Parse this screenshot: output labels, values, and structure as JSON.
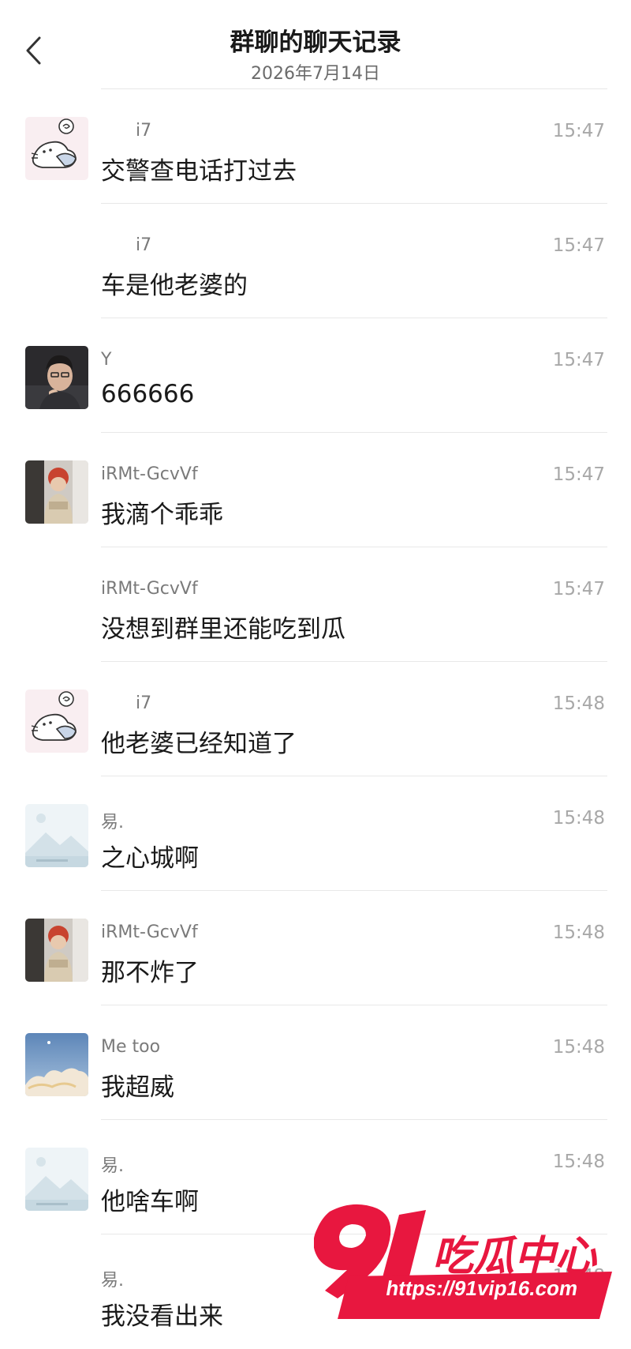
{
  "header": {
    "title": "群聊的聊天记录",
    "subtitle": "2026年7月14日"
  },
  "messages": [
    {
      "sender": "i7",
      "time": "15:47",
      "text": "交警查电话打过去",
      "avatar": "cat-cartoon"
    },
    {
      "sender": "i7",
      "time": "15:47",
      "text": "车是他老婆的",
      "avatar": ""
    },
    {
      "sender": "Y",
      "time": "15:47",
      "text": "666666",
      "avatar": "person-photo"
    },
    {
      "sender": "iRMt-GcvVf",
      "time": "15:47",
      "text": "我滴个乖乖",
      "avatar": "child-photo"
    },
    {
      "sender": "iRMt-GcvVf",
      "time": "15:47",
      "text": "没想到群里还能吃到瓜",
      "avatar": ""
    },
    {
      "sender": "i7",
      "time": "15:48",
      "text": "他老婆已经知道了",
      "avatar": "cat-cartoon"
    },
    {
      "sender": "易.",
      "time": "15:48",
      "text": "之心城啊",
      "avatar": "placeholder-landscape"
    },
    {
      "sender": "iRMt-GcvVf",
      "time": "15:48",
      "text": "那不炸了",
      "avatar": "child-photo"
    },
    {
      "sender": "Me too",
      "time": "15:48",
      "text": "我超威",
      "avatar": "sky-photo"
    },
    {
      "sender": "易.",
      "time": "15:48",
      "text": "他啥车啊",
      "avatar": "placeholder-landscape"
    },
    {
      "sender": "易.",
      "time": "15:48",
      "text": "我没看出来",
      "avatar": ""
    }
  ],
  "watermark": {
    "number": "91",
    "brand": "吃瓜中心",
    "url": "https://91vip16.com"
  },
  "colors": {
    "accent_red": "#e8173f",
    "text_primary": "#1a1a1a",
    "text_secondary": "#7a7a7a",
    "time": "#a8a8a8"
  }
}
